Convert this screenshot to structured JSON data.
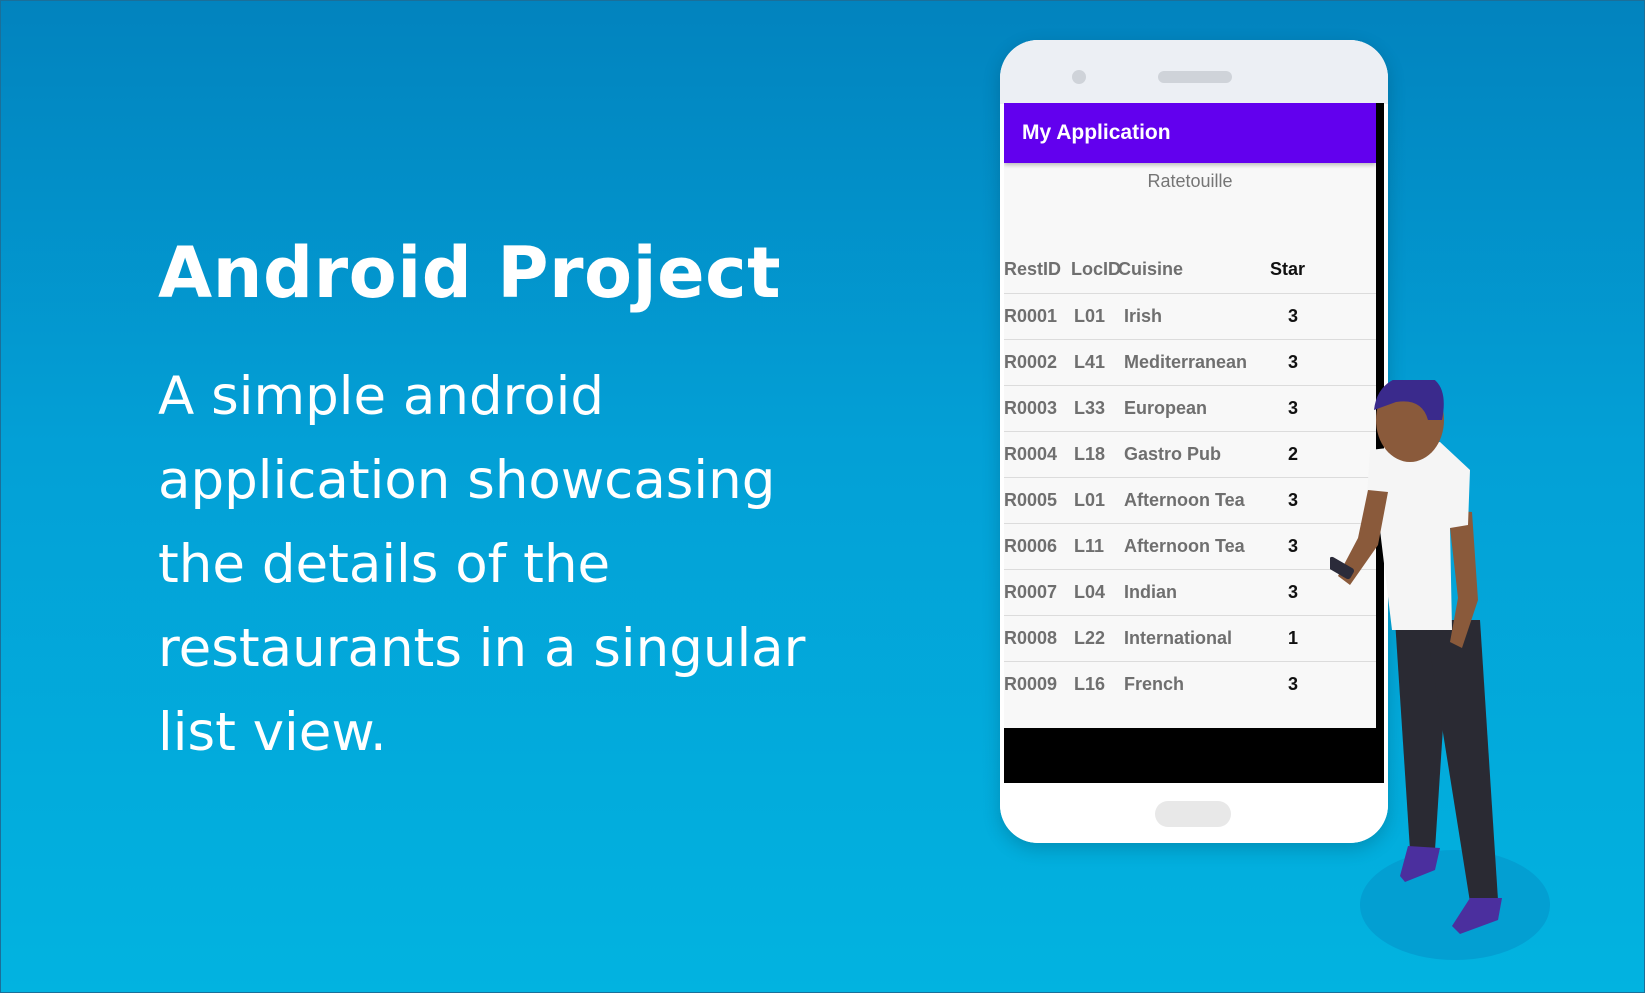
{
  "promo": {
    "headline": "Android Project",
    "description": "A simple android application showcasing the details of the restaurants in a singular list view."
  },
  "app": {
    "title": "My Application",
    "subtitle": "Ratetouille",
    "columns": [
      "RestID",
      "LocID",
      "Cuisine",
      "Star"
    ],
    "rows": [
      {
        "rest_id": "R0001",
        "loc_id": "L01",
        "cuisine": "Irish",
        "star": "3"
      },
      {
        "rest_id": "R0002",
        "loc_id": "L41",
        "cuisine": "Mediterranean",
        "star": "3"
      },
      {
        "rest_id": "R0003",
        "loc_id": "L33",
        "cuisine": "European",
        "star": "3"
      },
      {
        "rest_id": "R0004",
        "loc_id": "L18",
        "cuisine": "Gastro Pub",
        "star": "2"
      },
      {
        "rest_id": "R0005",
        "loc_id": "L01",
        "cuisine": "Afternoon Tea",
        "star": "3"
      },
      {
        "rest_id": "R0006",
        "loc_id": "L11",
        "cuisine": "Afternoon Tea",
        "star": "3"
      },
      {
        "rest_id": "R0007",
        "loc_id": "L04",
        "cuisine": "Indian",
        "star": "3"
      },
      {
        "rest_id": "R0008",
        "loc_id": "L22",
        "cuisine": "International",
        "star": "1"
      },
      {
        "rest_id": "R0009",
        "loc_id": "L16",
        "cuisine": "French",
        "star": "3"
      }
    ]
  },
  "colors": {
    "background_top": "#0283be",
    "background_bottom": "#02b3e0",
    "app_bar": "#6200ee",
    "person_shirt": "#f5f5f5",
    "person_hair": "#3a2a8c",
    "person_pants": "#2a2a33",
    "person_shoes": "#4b2f9e"
  }
}
